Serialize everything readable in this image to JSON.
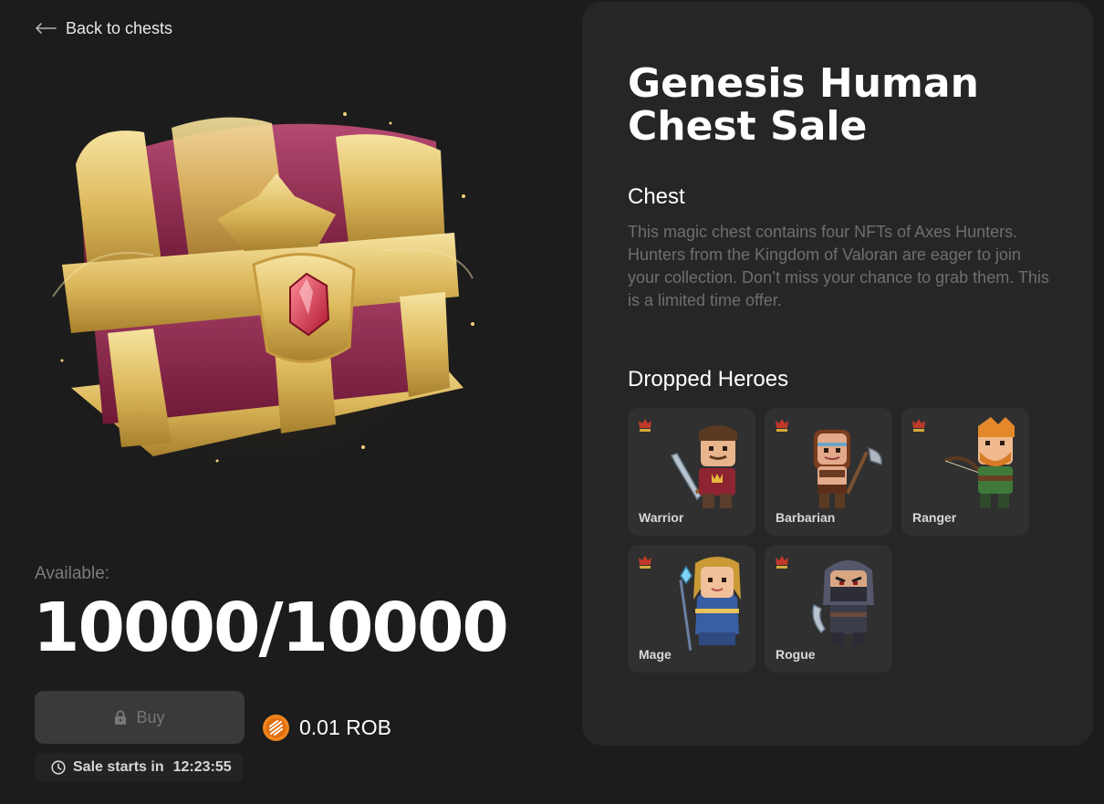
{
  "nav": {
    "back_label": "Back to chests"
  },
  "availability": {
    "label": "Available:",
    "value": "10000/10000"
  },
  "purchase": {
    "buy_label": "Buy",
    "price": "0.01 ROB",
    "sale_label": "Sale starts in",
    "countdown": "12:23:55"
  },
  "details": {
    "title": "Genesis Human Chest Sale",
    "chest_heading": "Chest",
    "chest_description": "This magic chest contains four NFTs of Axes Hunters. Hunters from the Kingdom of Valoran are eager to join your collection. Don’t miss your chance to grab them. This is a limited time offer.",
    "heroes_heading": "Dropped Heroes",
    "heroes": [
      {
        "name": "Warrior",
        "icon": "warrior-icon"
      },
      {
        "name": "Barbarian",
        "icon": "barbarian-icon"
      },
      {
        "name": "Ranger",
        "icon": "ranger-icon"
      },
      {
        "name": "Mage",
        "icon": "mage-icon"
      },
      {
        "name": "Rogue",
        "icon": "rogue-icon"
      }
    ]
  },
  "colors": {
    "background": "#1c1c1c",
    "panel": "#262626",
    "card": "#303030",
    "button_disabled": "#3a3a3a",
    "muted_text": "#6f6f6f",
    "coin_orange": "#f0841e",
    "chest_gold": "#e7c66a",
    "chest_red": "#8d2148"
  }
}
